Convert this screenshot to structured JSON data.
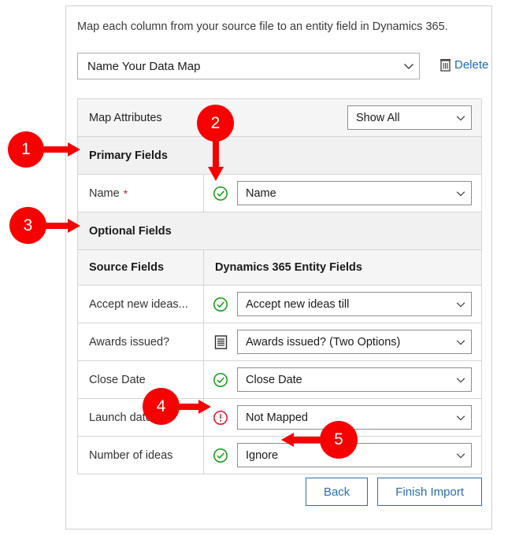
{
  "dialog": {
    "intro_text": "Map each column from your source file to an entity field in Dynamics 365.",
    "data_map": {
      "selected": "Name Your Data Map",
      "chevron_icon": "chevron-down-icon"
    },
    "delete": {
      "label": "Delete",
      "icon": "trash-icon"
    },
    "attributes_bar": {
      "label": "Map Attributes",
      "filter_selected": "Show All",
      "chevron_icon": "chevron-down-icon"
    },
    "sections": {
      "primary": "Primary Fields",
      "optional": "Optional Fields"
    },
    "columns": {
      "source": "Source Fields",
      "target": "Dynamics 365 Entity Fields"
    },
    "primary_rows": [
      {
        "source": "Name",
        "required": "*",
        "status_icon": "check-circle-icon",
        "status": "ok",
        "target": "Name"
      }
    ],
    "optional_rows": [
      {
        "source": "Accept new ideas...",
        "status_icon": "check-circle-icon",
        "status": "ok",
        "target": "Accept new ideas till"
      },
      {
        "source": "Awards issued?",
        "status_icon": "list-icon",
        "status": "list",
        "target": "Awards issued? (Two Options)"
      },
      {
        "source": "Close Date",
        "status_icon": "check-circle-icon",
        "status": "ok",
        "target": "Close Date"
      },
      {
        "source": "Launch date",
        "status_icon": "error-circle-icon",
        "status": "error",
        "target": "Not Mapped"
      },
      {
        "source": "Number of ideas",
        "status_icon": "check-circle-icon",
        "status": "ok",
        "target": "Ignore"
      }
    ],
    "footer": {
      "back_label": "Back",
      "finish_label": "Finish Import"
    }
  },
  "callouts": [
    {
      "number": "1"
    },
    {
      "number": "2"
    },
    {
      "number": "3"
    },
    {
      "number": "4"
    },
    {
      "number": "5"
    }
  ],
  "colors": {
    "callout_red": "#f90000",
    "link_blue": "#1f6cb0",
    "button_blue": "#2a6fb0",
    "ok_green": "#119c11",
    "error_red": "#e81123",
    "required_red": "#e81123"
  }
}
